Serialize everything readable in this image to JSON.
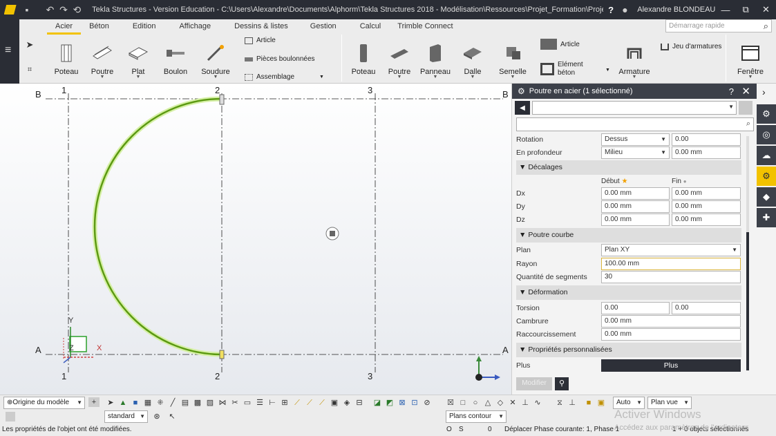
{
  "titlebar": {
    "title": "Tekla Structures - Version Education - C:\\Users\\Alexandre\\Documents\\Alphorm\\Tekla Structures 2018 - Modélisation\\Ressources\\Projet_Formation\\Projet_Form...",
    "help": "?",
    "user": "Alexandre BLONDEAU",
    "buttons": {
      "minimize": "—",
      "restore": "⧉",
      "close": "✕"
    }
  },
  "ribbon": {
    "tabs": [
      "Acier",
      "Béton",
      "Edition",
      "Affichage",
      "Dessins & listes",
      "Gestion",
      "Calcul",
      "Trimble Connect"
    ],
    "active_tab": "Acier",
    "quick_search_placeholder": "Démarrage rapide",
    "steel": {
      "poteau": "Poteau",
      "poutre": "Poutre",
      "plat": "Plat",
      "boulon": "Boulon",
      "soudure": "Soudure",
      "article": "Article",
      "pieces_boulonnees": "Pièces boulonnées",
      "assemblage": "Assemblage"
    },
    "concrete": {
      "poteau": "Poteau",
      "poutre": "Poutre",
      "panneau": "Panneau",
      "dalle": "Dalle",
      "semelle": "Semelle",
      "article": "Article",
      "element_beton_1": "Elément",
      "element_beton_2": "béton",
      "armature": "Armature",
      "jeu_armatures": "Jeu d'armatures"
    },
    "fenetre": "Fenêtre"
  },
  "viewport": {
    "grid_top": [
      "1",
      "2",
      "3"
    ],
    "grid_bottom": [
      "1",
      "2",
      "3"
    ],
    "row_top_left": "B",
    "row_top_right": "B",
    "row_bottom_left": "A",
    "row_bottom_right": "A",
    "axis_y": "Y",
    "axis_x": "X",
    "axis_z": "Z"
  },
  "panel": {
    "title": "Poutre en acier (1 sélectionné)",
    "help": "?",
    "rows": {
      "rotation_label": "Rotation",
      "rotation_value": "Dessus",
      "rotation_angle": "0.00",
      "profondeur_label": "En profondeur",
      "profondeur_value": "Milieu",
      "profondeur_offset": "0.00 mm",
      "decalages": "Décalages",
      "debut": "Début",
      "fin": "Fin",
      "dx_label": "Dx",
      "dx_debut": "0.00 mm",
      "dx_fin": "0.00 mm",
      "dy_label": "Dy",
      "dy_debut": "0.00 mm",
      "dy_fin": "0.00 mm",
      "dz_label": "Dz",
      "dz_debut": "0.00 mm",
      "dz_fin": "0.00 mm",
      "poutre_courbe": "Poutre courbe",
      "plan_label": "Plan",
      "plan_value": "Plan XY",
      "rayon_label": "Rayon",
      "rayon_value": "100.00 mm",
      "segments_label": "Quantité de segments",
      "segments_value": "30",
      "deformation": "Déformation",
      "torsion_label": "Torsion",
      "torsion_1": "0.00",
      "torsion_2": "0.00",
      "cambrure_label": "Cambrure",
      "cambrure_value": "0.00 mm",
      "raccourcissement_label": "Raccourcissement",
      "raccourcissement_value": "0.00 mm",
      "proprietes": "Propriétés personnalisées",
      "plus_label": "Plus",
      "plus_button": "Plus"
    },
    "modifier": "Modifier"
  },
  "bottombar": {
    "origin": "Origine du modèle",
    "standard": "standard",
    "auto": "Auto",
    "plan_vue": "Plan vue",
    "plans_contour": "Plans contour"
  },
  "statusbar": {
    "message": "Les propriétés de l'objet ont été modifiées.",
    "o": "O",
    "s": "S",
    "zero": "0",
    "phase": "Déplacer Phase courante: 1, Phase 1",
    "selection": "1 + 0 objets sélectionnés"
  },
  "watermark": {
    "line1": "Activer Windows",
    "line2": "Accédez aux paramètres de l'ordinateur"
  },
  "colors": {
    "accent": "#f2c200",
    "dark": "#2a2d35",
    "beam": "#7ec320"
  }
}
